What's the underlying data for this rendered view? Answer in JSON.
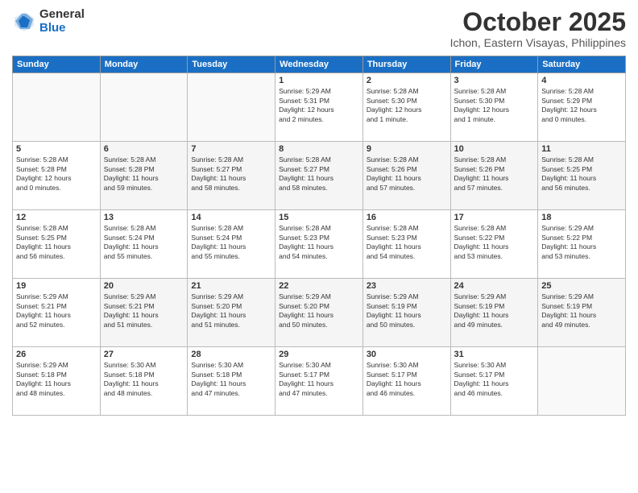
{
  "header": {
    "logo_general": "General",
    "logo_blue": "Blue",
    "month_title": "October 2025",
    "location": "Ichon, Eastern Visayas, Philippines"
  },
  "weekdays": [
    "Sunday",
    "Monday",
    "Tuesday",
    "Wednesday",
    "Thursday",
    "Friday",
    "Saturday"
  ],
  "weeks": [
    [
      {
        "day": "",
        "info": ""
      },
      {
        "day": "",
        "info": ""
      },
      {
        "day": "",
        "info": ""
      },
      {
        "day": "1",
        "info": "Sunrise: 5:29 AM\nSunset: 5:31 PM\nDaylight: 12 hours\nand 2 minutes."
      },
      {
        "day": "2",
        "info": "Sunrise: 5:28 AM\nSunset: 5:30 PM\nDaylight: 12 hours\nand 1 minute."
      },
      {
        "day": "3",
        "info": "Sunrise: 5:28 AM\nSunset: 5:30 PM\nDaylight: 12 hours\nand 1 minute."
      },
      {
        "day": "4",
        "info": "Sunrise: 5:28 AM\nSunset: 5:29 PM\nDaylight: 12 hours\nand 0 minutes."
      }
    ],
    [
      {
        "day": "5",
        "info": "Sunrise: 5:28 AM\nSunset: 5:28 PM\nDaylight: 12 hours\nand 0 minutes."
      },
      {
        "day": "6",
        "info": "Sunrise: 5:28 AM\nSunset: 5:28 PM\nDaylight: 11 hours\nand 59 minutes."
      },
      {
        "day": "7",
        "info": "Sunrise: 5:28 AM\nSunset: 5:27 PM\nDaylight: 11 hours\nand 58 minutes."
      },
      {
        "day": "8",
        "info": "Sunrise: 5:28 AM\nSunset: 5:27 PM\nDaylight: 11 hours\nand 58 minutes."
      },
      {
        "day": "9",
        "info": "Sunrise: 5:28 AM\nSunset: 5:26 PM\nDaylight: 11 hours\nand 57 minutes."
      },
      {
        "day": "10",
        "info": "Sunrise: 5:28 AM\nSunset: 5:26 PM\nDaylight: 11 hours\nand 57 minutes."
      },
      {
        "day": "11",
        "info": "Sunrise: 5:28 AM\nSunset: 5:25 PM\nDaylight: 11 hours\nand 56 minutes."
      }
    ],
    [
      {
        "day": "12",
        "info": "Sunrise: 5:28 AM\nSunset: 5:25 PM\nDaylight: 11 hours\nand 56 minutes."
      },
      {
        "day": "13",
        "info": "Sunrise: 5:28 AM\nSunset: 5:24 PM\nDaylight: 11 hours\nand 55 minutes."
      },
      {
        "day": "14",
        "info": "Sunrise: 5:28 AM\nSunset: 5:24 PM\nDaylight: 11 hours\nand 55 minutes."
      },
      {
        "day": "15",
        "info": "Sunrise: 5:28 AM\nSunset: 5:23 PM\nDaylight: 11 hours\nand 54 minutes."
      },
      {
        "day": "16",
        "info": "Sunrise: 5:28 AM\nSunset: 5:23 PM\nDaylight: 11 hours\nand 54 minutes."
      },
      {
        "day": "17",
        "info": "Sunrise: 5:28 AM\nSunset: 5:22 PM\nDaylight: 11 hours\nand 53 minutes."
      },
      {
        "day": "18",
        "info": "Sunrise: 5:29 AM\nSunset: 5:22 PM\nDaylight: 11 hours\nand 53 minutes."
      }
    ],
    [
      {
        "day": "19",
        "info": "Sunrise: 5:29 AM\nSunset: 5:21 PM\nDaylight: 11 hours\nand 52 minutes."
      },
      {
        "day": "20",
        "info": "Sunrise: 5:29 AM\nSunset: 5:21 PM\nDaylight: 11 hours\nand 51 minutes."
      },
      {
        "day": "21",
        "info": "Sunrise: 5:29 AM\nSunset: 5:20 PM\nDaylight: 11 hours\nand 51 minutes."
      },
      {
        "day": "22",
        "info": "Sunrise: 5:29 AM\nSunset: 5:20 PM\nDaylight: 11 hours\nand 50 minutes."
      },
      {
        "day": "23",
        "info": "Sunrise: 5:29 AM\nSunset: 5:19 PM\nDaylight: 11 hours\nand 50 minutes."
      },
      {
        "day": "24",
        "info": "Sunrise: 5:29 AM\nSunset: 5:19 PM\nDaylight: 11 hours\nand 49 minutes."
      },
      {
        "day": "25",
        "info": "Sunrise: 5:29 AM\nSunset: 5:19 PM\nDaylight: 11 hours\nand 49 minutes."
      }
    ],
    [
      {
        "day": "26",
        "info": "Sunrise: 5:29 AM\nSunset: 5:18 PM\nDaylight: 11 hours\nand 48 minutes."
      },
      {
        "day": "27",
        "info": "Sunrise: 5:30 AM\nSunset: 5:18 PM\nDaylight: 11 hours\nand 48 minutes."
      },
      {
        "day": "28",
        "info": "Sunrise: 5:30 AM\nSunset: 5:18 PM\nDaylight: 11 hours\nand 47 minutes."
      },
      {
        "day": "29",
        "info": "Sunrise: 5:30 AM\nSunset: 5:17 PM\nDaylight: 11 hours\nand 47 minutes."
      },
      {
        "day": "30",
        "info": "Sunrise: 5:30 AM\nSunset: 5:17 PM\nDaylight: 11 hours\nand 46 minutes."
      },
      {
        "day": "31",
        "info": "Sunrise: 5:30 AM\nSunset: 5:17 PM\nDaylight: 11 hours\nand 46 minutes."
      },
      {
        "day": "",
        "info": ""
      }
    ]
  ]
}
